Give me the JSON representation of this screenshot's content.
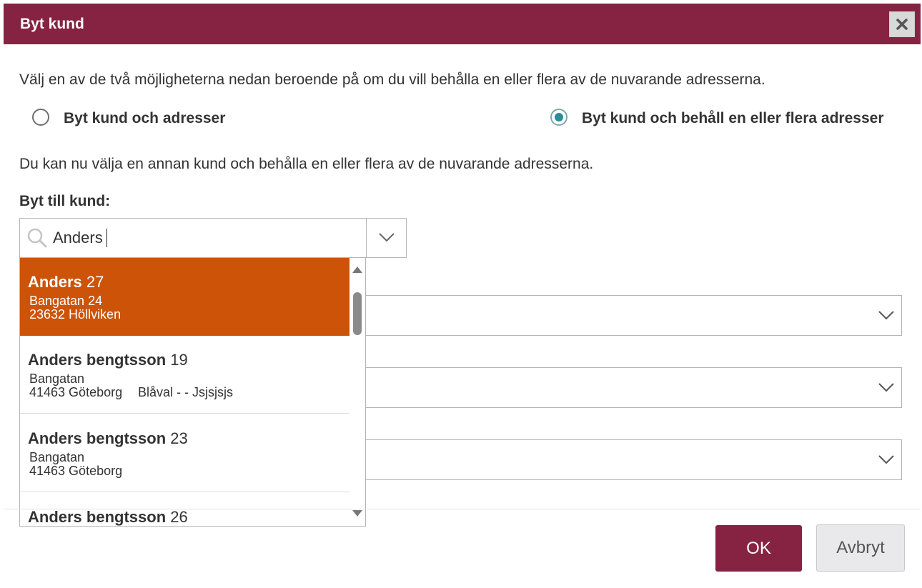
{
  "dialog": {
    "title": "Byt kund",
    "close_icon": "close-icon"
  },
  "intro_text": "Välj en av de två möjligheterna nedan beroende på om du vill behålla en eller flera av de nuvarande adresserna.",
  "options": [
    {
      "label": "Byt kund och adresser",
      "checked": false
    },
    {
      "label": "Byt kund och behåll en eller flera adresser",
      "checked": true
    }
  ],
  "info_text": "Du kan nu välja en annan kund och behålla en eller flera av de nuvarande adresserna.",
  "customer_field": {
    "label": "Byt till kund:",
    "value": "Anders",
    "search_icon": "search-icon",
    "dropdown_icon": "chevron-down-icon"
  },
  "results": [
    {
      "name": "Anders",
      "number": "27",
      "street": "Bangatan 24",
      "postal": "23632 Höllviken",
      "extra": "",
      "selected": true
    },
    {
      "name": "Anders bengtsson",
      "number": "19",
      "street": "Bangatan",
      "postal": "41463 Göteborg",
      "extra": "Blåval - - Jsjsjsjs",
      "selected": false
    },
    {
      "name": "Anders bengtsson",
      "number": "23",
      "street": "Bangatan",
      "postal": "41463 Göteborg",
      "extra": "",
      "selected": false
    },
    {
      "name": "Anders bengtsson",
      "number": "26",
      "street": "",
      "postal": "",
      "extra": "",
      "selected": false
    }
  ],
  "buttons": {
    "ok": "OK",
    "cancel": "Avbryt"
  },
  "colors": {
    "brand": "#872342",
    "highlight": "#cc5307",
    "radio_checked": "#2e8b9a"
  }
}
